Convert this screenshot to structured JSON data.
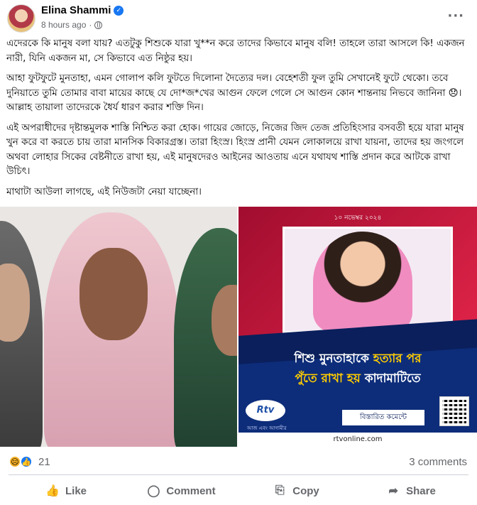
{
  "post": {
    "author": "Elina Shammi",
    "timestamp": "8 hours ago",
    "separator": "·",
    "more_icon": "more-horizontal-icon",
    "paragraphs": [
      "এদেরকে কি মানুষ বলা যায়? এতটুকু শিশুকে যারা খু**ন করে তাদের কিভাবে মানুষ বলি!  তাহলে তারা আসলে কি!  একজন নারী, যিনি একজন মা, সে কিভাবে এত নিষ্ঠুর হয়।",
      "আহা ফুটফুটে মুনতাহা, এমন গোলাপ কলি ফুটতে দিলোনা দৈত্যের দল। বেহেশতী ফুল তুমি সেখানেই ফুটে থেকো। তবে দুনিয়াতে তুমি তোমার বাবা মায়ের কাছে যে দো*জ*খের আগুন ফেলে গেলে সে আগুন কোন শান্তনায় নিভবে জানিনা 😞। আল্লাহ তায়ালা তাদেরকে ধৈর্য ধারণ করার শক্তি দিন।",
      "এই অপরাধীদের দৃষ্টান্তমুলক শাস্তি নিশ্চিত করা হোক। গায়ের জোড়ে, নিজের জিদ তেজ প্রতিহিংসার বসবতী হয়ে যারা মানুষ খুন করে বা করতে চায় তারা মানসিক বিকারগ্রস্ত। তারা হিংস্র। হিংস্র প্রানী যেমন লোকালয়ে রাখা যায়না, তাদের হয় জংগলে অথবা লোহার সিকের বেষ্টনীতে রাখা হয়, এই মানুষদেরও আইনের আওতায় এনে যথাযথ শাস্তি প্রদান করে আটকে রাখা উচিৎ।",
      "মাথাটা আউলা লাগছে, এই নিউজটা নেয়া যাচ্ছেনা।"
    ]
  },
  "media": {
    "news_card": {
      "date": "১০ নভেম্বর ২০২৪",
      "headline_line1_a": "শিশু মুনতাহাকে ",
      "headline_line1_b": "হত্যার পর",
      "headline_line2_a": "পুঁতে রাখা হয় ",
      "headline_line2_b": "কাদামাটিতে",
      "logo_text": "Rtv",
      "logo_tagline": "আজ এবং আগামীর",
      "details_button": "বিস্তারিত কমেন্টে",
      "site": "rtvonline.com"
    }
  },
  "footer": {
    "reaction_icons": [
      "sad-reaction-icon",
      "like-reaction-icon"
    ],
    "reaction_count": "21",
    "comments": "3 comments",
    "actions": [
      {
        "label": "Like",
        "icon": "thumbs-up-icon"
      },
      {
        "label": "Comment",
        "icon": "comment-bubble-icon"
      },
      {
        "label": "Copy",
        "icon": "copy-link-icon"
      },
      {
        "label": "Share",
        "icon": "share-arrow-icon"
      }
    ]
  },
  "colors": {
    "verified_badge": "#1877f2",
    "secondary_text": "#65676b",
    "news_red": "#e02448",
    "news_blue": "#0d2d7a",
    "headline_accent": "#ffcc00"
  }
}
